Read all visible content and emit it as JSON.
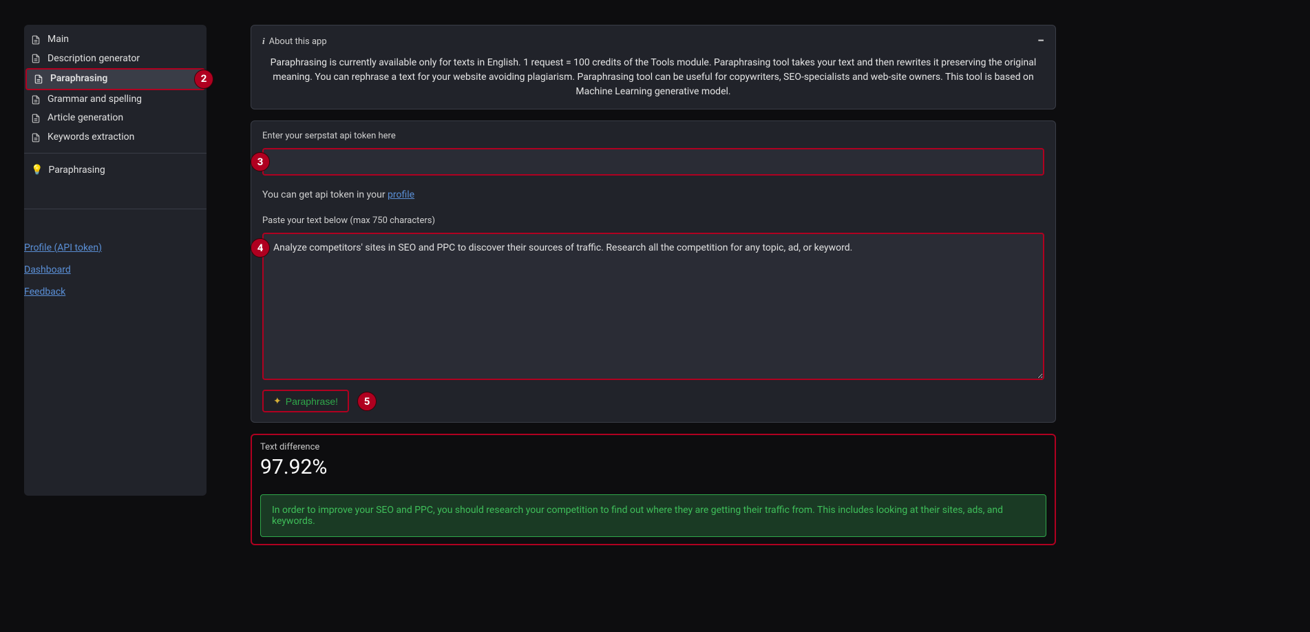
{
  "sidebar": {
    "items": [
      {
        "label": "Main"
      },
      {
        "label": "Description generator"
      },
      {
        "label": "Paraphrasing",
        "active": true,
        "badge": "2"
      },
      {
        "label": "Grammar and spelling"
      },
      {
        "label": "Article generation"
      },
      {
        "label": "Keywords extraction"
      }
    ],
    "sub": {
      "label": "Paraphrasing"
    },
    "links": [
      {
        "label": "Profile (API token)"
      },
      {
        "label": "Dashboard"
      },
      {
        "label": "Feedback"
      }
    ]
  },
  "about": {
    "title": "About this app",
    "text": "Paraphrasing is currently available only for texts in English. 1 request = 100 credits of the Tools module. Paraphrasing tool takes your text and then rewrites it preserving the original meaning. You can rephrase a text for your website avoiding plagiarism. Paraphrasing tool can be useful for copywriters, SEO-specialists and web-site owners. This tool is based on Machine Learning generative model."
  },
  "form": {
    "token_label": "Enter your serpstat api token here",
    "token_value": "",
    "token_badge": "3",
    "hint_prefix": "You can get api token in your ",
    "hint_link": "profile",
    "paste_label": "Paste your text below (max 750 characters)",
    "paste_value": "Analyze competitors' sites in SEO and PPC to discover their sources of traffic. Research all the competition for any topic, ad, or keyword.",
    "paste_badge": "4",
    "button_label": "Paraphrase!",
    "button_badge": "5"
  },
  "result": {
    "label": "Text difference",
    "value": "97.92%",
    "output": "In order to improve your SEO and PPC, you should research your competition to find out where they are getting their traffic from. This includes looking at their sites, ads, and keywords."
  }
}
